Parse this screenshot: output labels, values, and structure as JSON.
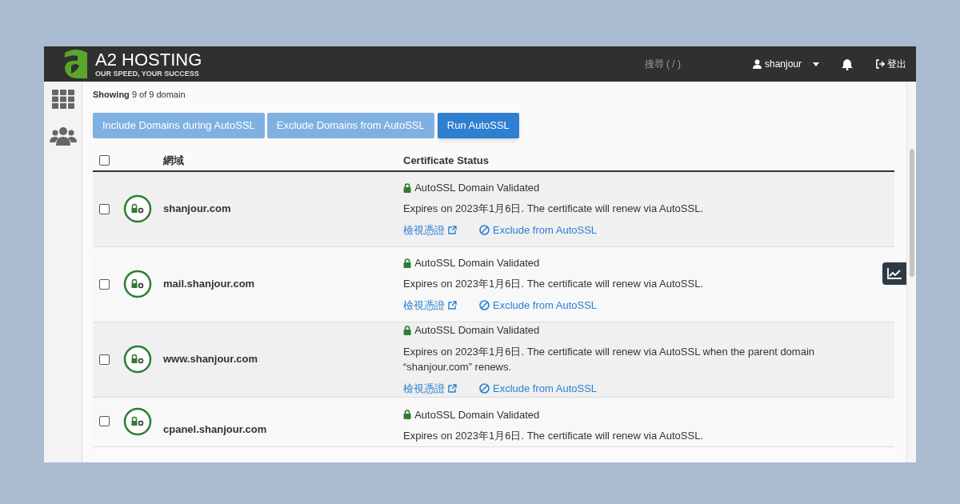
{
  "header": {
    "logo_title": "A2 HOSTING",
    "logo_tagline": "OUR SPEED, YOUR SUCCESS",
    "search": "搜尋 ( / )",
    "user": "shanjour",
    "logout": "登出"
  },
  "showing": "**Showing** 9 of 9 domain",
  "buttons": [
    {
      "label": "Include Domains during AutoSSL",
      "kind": "light"
    },
    {
      "label": "Exclude Domains from AutoSSL",
      "kind": "light"
    },
    {
      "label": "Run AutoSSL",
      "kind": "primary"
    }
  ],
  "table": {
    "select_all_checked": false,
    "columns": [
      "網域",
      "Certificate Status"
    ],
    "rows": [
      {
        "domain": "shanjour.com",
        "checked": false,
        "status": "AutoSSL Domain Validated",
        "expires": "Expires on 2023年1月6日. The certificate will renew via AutoSSL.",
        "view_link": "檢視憑證",
        "exclude_link": "Exclude from AutoSSL"
      },
      {
        "domain": "mail.shanjour.com",
        "checked": false,
        "status": "AutoSSL Domain Validated",
        "expires": "Expires on 2023年1月6日. The certificate will renew via AutoSSL.",
        "view_link": "檢視憑證",
        "exclude_link": "Exclude from AutoSSL"
      },
      {
        "domain": "www.shanjour.com",
        "checked": false,
        "status": "AutoSSL Domain Validated",
        "expires": "Expires on 2023年1月6日. The certificate will renew via AutoSSL when the parent domain “shanjour.com” renews.",
        "view_link": "檢視憑證",
        "exclude_link": "Exclude from AutoSSL"
      },
      {
        "domain": "cpanel.shanjour.com",
        "checked": false,
        "status": "AutoSSL Domain Validated",
        "expires": "Expires on 2023年1月6日. The certificate will renew via AutoSSL."
      }
    ]
  }
}
